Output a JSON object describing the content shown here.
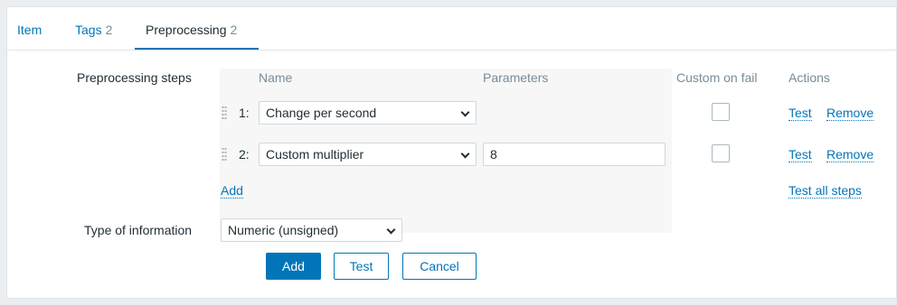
{
  "tabs": [
    {
      "label": "Item",
      "count": ""
    },
    {
      "label": "Tags",
      "count": "2"
    },
    {
      "label": "Preprocessing",
      "count": "2"
    }
  ],
  "form": {
    "preprocessing_label": "Preprocessing steps",
    "headers": {
      "name": "Name",
      "parameters": "Parameters",
      "custom_on_fail": "Custom on fail",
      "actions": "Actions"
    },
    "steps": [
      {
        "number": "1:",
        "name": "Change per second",
        "parameter": "",
        "custom_on_fail": false,
        "test": "Test",
        "remove": "Remove"
      },
      {
        "number": "2:",
        "name": "Custom multiplier",
        "parameter": "8",
        "custom_on_fail": false,
        "test": "Test",
        "remove": "Remove"
      }
    ],
    "add_link": "Add",
    "test_all_link": "Test all steps",
    "type_label": "Type of information",
    "type_value": "Numeric (unsigned)"
  },
  "buttons": {
    "add": "Add",
    "test": "Test",
    "cancel": "Cancel"
  },
  "colors": {
    "accent": "#0275b8",
    "muted": "#768d99",
    "text": "#1f2c33"
  }
}
